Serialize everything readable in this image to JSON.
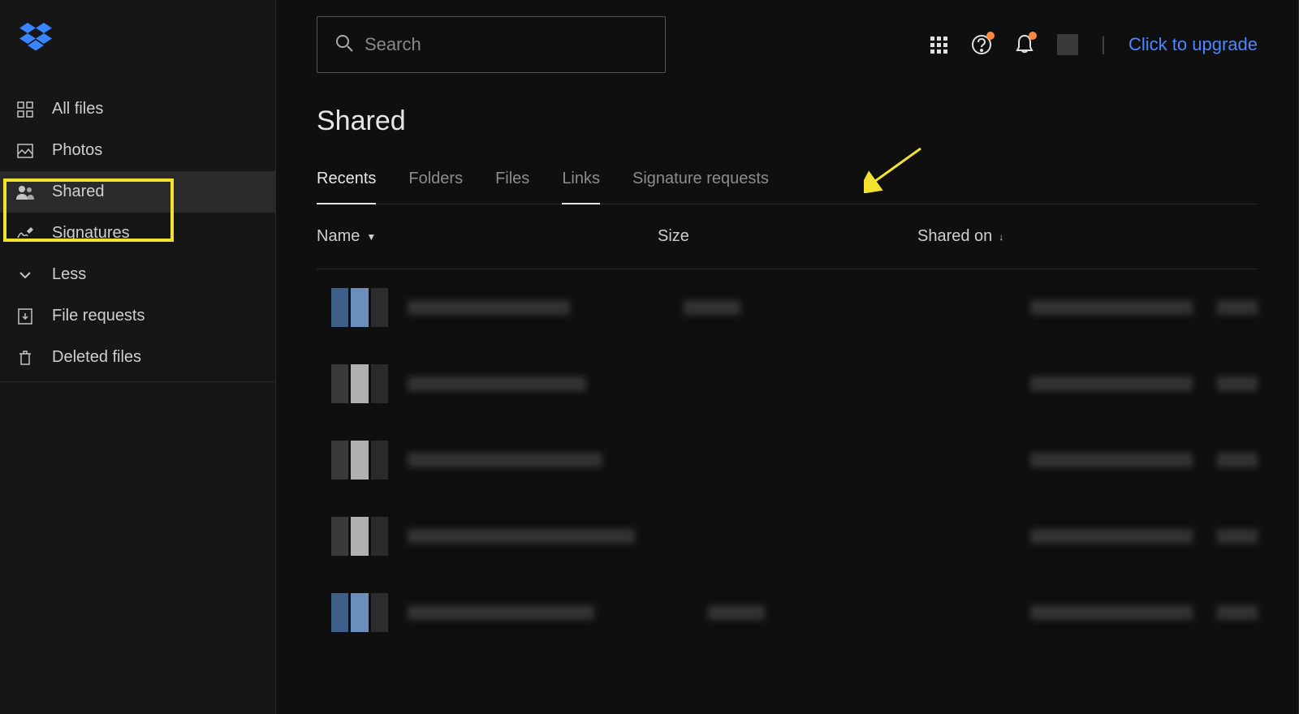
{
  "sidebar": {
    "items": [
      {
        "label": "All files",
        "icon": "grid-icon"
      },
      {
        "label": "Photos",
        "icon": "image-icon"
      },
      {
        "label": "Shared",
        "icon": "people-icon",
        "active": true
      },
      {
        "label": "Signatures",
        "icon": "signature-icon"
      },
      {
        "label": "Less",
        "icon": "chevron-down-icon"
      },
      {
        "label": "File requests",
        "icon": "file-download-icon"
      },
      {
        "label": "Deleted files",
        "icon": "trash-icon"
      }
    ]
  },
  "header": {
    "search_placeholder": "Search",
    "upgrade_label": "Click to upgrade"
  },
  "page": {
    "title": "Shared",
    "tabs": [
      {
        "label": "Recents",
        "active": true
      },
      {
        "label": "Folders"
      },
      {
        "label": "Files"
      },
      {
        "label": "Links",
        "annotated": true
      },
      {
        "label": "Signature requests"
      }
    ],
    "columns": {
      "name": "Name",
      "size": "Size",
      "shared_on": "Shared on"
    }
  },
  "annotation": {
    "highlight_target": "Shared",
    "arrow_target": "Links"
  }
}
